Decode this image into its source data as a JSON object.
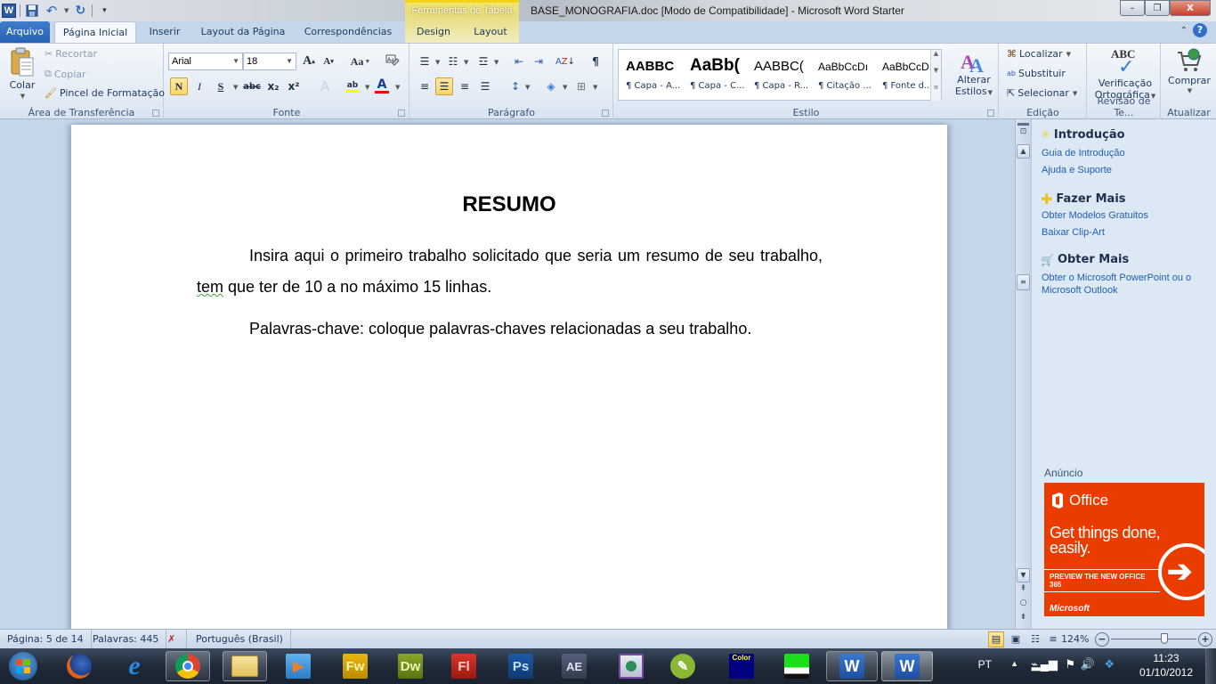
{
  "window": {
    "title": "BASE_MONOGRAFIA.doc [Modo de Compatibilidade]  -  Microsoft Word Starter",
    "minimize": "–",
    "maximize": "❐",
    "close": "X"
  },
  "qat": {
    "logo": "W",
    "save": "💾",
    "undo": "↶",
    "redo": "↻",
    "customize": "▾"
  },
  "context_tab_group": "Ferramentas de Tabela",
  "tabs": [
    {
      "label": "Arquivo"
    },
    {
      "label": "Página Inicial"
    },
    {
      "label": "Inserir"
    },
    {
      "label": "Layout da Página"
    },
    {
      "label": "Correspondências"
    },
    {
      "label": "Design"
    },
    {
      "label": "Layout"
    }
  ],
  "ribbon": {
    "clipboard": {
      "label": "Área de Transferência",
      "paste": "Colar",
      "cut": "Recortar",
      "copy": "Copiar",
      "format_painter": "Pincel de Formatação"
    },
    "font": {
      "label": "Fonte",
      "font_name": "Arial",
      "font_size": "18",
      "grow": "A",
      "shrink": "A",
      "change_case": "Aa",
      "bold": "N",
      "italic": "I",
      "underline": "S",
      "strike": "abc",
      "subscript": "x₂",
      "superscript": "x²",
      "effects": "A",
      "highlight": "ab",
      "font_color": "A",
      "highlight_color": "#ffff00",
      "font_color_value": "#ff0000"
    },
    "paragraph": {
      "label": "Parágrafo",
      "show_marks": "¶"
    },
    "styles": {
      "label": "Estilo",
      "items": [
        {
          "sample": "AABBC",
          "name": "¶ Capa - A..."
        },
        {
          "sample": "AaBb(",
          "name": "¶ Capa - C..."
        },
        {
          "sample": "AABBC(",
          "name": "¶ Capa - R..."
        },
        {
          "sample": "AaBbCcDı",
          "name": "¶ Citação ..."
        },
        {
          "sample": "AaBbCcDı",
          "name": "¶ Fonte d..."
        }
      ],
      "change_styles_line1": "Alterar",
      "change_styles_line2": "Estilos"
    },
    "editing": {
      "label": "Edição",
      "find": "Localizar",
      "replace": "Substituir",
      "select": "Selecionar"
    },
    "proofing": {
      "label": "Revisão de Te...",
      "spelling_line1": "Verificação",
      "spelling_line2": "Ortográfica",
      "abc": "ABC"
    },
    "upgrade": {
      "label": "Atualizar",
      "buy": "Comprar"
    }
  },
  "document": {
    "title": "RESUMO",
    "para1_a": "Insira aqui o primeiro trabalho solicitado que seria um resumo de seu trabalho, ",
    "para1_squiggle": "tem",
    "para1_b": " que ter de 10 a no máximo 15 linhas.",
    "para2": "Palavras-chave: coloque palavras-chaves relacionadas a seu trabalho."
  },
  "right_pane": {
    "sections": [
      {
        "title": "Introdução",
        "links": [
          "Guia de Introdução",
          "Ajuda e Suporte"
        ]
      },
      {
        "title": "Fazer Mais",
        "links": [
          "Obter Modelos Gratuitos",
          "Baixar Clip-Art"
        ]
      },
      {
        "title": "Obter Mais",
        "links": [
          "Obter o Microsoft PowerPoint ou o Microsoft Outlook"
        ]
      }
    ],
    "ad_label": "Anúncio",
    "ad": {
      "brand": "Office",
      "headline": "Get things done, easily.",
      "cta": "PREVIEW THE NEW OFFICE 365",
      "footer": "Microsoft",
      "background": "#eb3c00"
    }
  },
  "statusbar": {
    "page": "Página: 5 de 14",
    "words": "Palavras: 445",
    "language": "Português (Brasil)",
    "zoom": "124%",
    "zoom_minus": "−",
    "zoom_plus": "+",
    "zoom_slider_fraction": 0.62
  },
  "taskbar": {
    "apps": [
      {
        "name": "start",
        "label": ""
      },
      {
        "name": "firefox",
        "label": ""
      },
      {
        "name": "internet-explorer",
        "label": "e"
      },
      {
        "name": "chrome",
        "label": ""
      },
      {
        "name": "windows-explorer",
        "label": ""
      },
      {
        "name": "media-player",
        "label": "▶"
      },
      {
        "name": "fireworks",
        "label": "Fw"
      },
      {
        "name": "dreamweaver",
        "label": "Dw"
      },
      {
        "name": "flash",
        "label": "Fl"
      },
      {
        "name": "photoshop",
        "label": "Ps"
      },
      {
        "name": "after-effects",
        "label": "AE"
      },
      {
        "name": "remote-desktop",
        "label": ""
      },
      {
        "name": "coreldraw",
        "label": ""
      },
      {
        "name": "colorcop",
        "label": "Color"
      },
      {
        "name": "image-app",
        "label": ""
      },
      {
        "name": "word-1",
        "label": "W"
      },
      {
        "name": "word-2",
        "label": "W"
      }
    ],
    "tray": {
      "language": "PT",
      "time": "11:23",
      "date": "01/10/2012"
    }
  }
}
